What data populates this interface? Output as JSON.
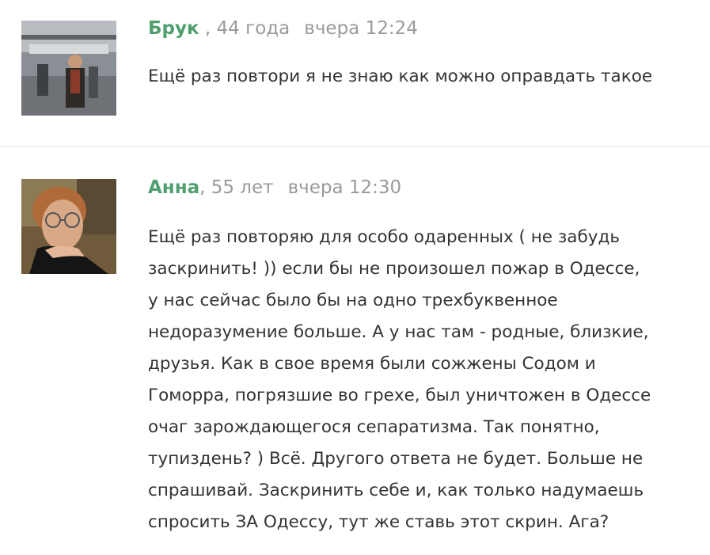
{
  "comments": [
    {
      "author": "Брук",
      "age": " , 44 года",
      "time": "вчера 12:24",
      "lines": [
        "Ещё раз повтори я не знаю как можно оправдать такое"
      ]
    },
    {
      "author": "Анна",
      "age": ", 55 лет",
      "time": "вчера 12:30",
      "lines": [
        "Ещё раз повторяю для особо одаренных ( не забудь",
        "заскринить! )) если бы не произошел пожар в Одессе,",
        "у нас сейчас было бы на одно трехбуквенное",
        "недоразумение больше. А у нас там - родные, близкие,",
        "друзья. Как в свое время были сожжены Содом и",
        "Гоморра, погрязшие во грехе, был уничтожен в Одессе",
        "очаг зарождающегося сепаратизма. Так понятно,",
        "тупиздень? ) Всё. Другого ответа не будет. Больше не",
        "спрашивай. Заскринить себе и, как только надумаешь",
        "спросить ЗА Одессу, тут же ставь этот скрин. Ага?"
      ]
    }
  ],
  "colors": {
    "author": "#4f9f6e",
    "meta": "#9a9a9a",
    "text": "#333333",
    "divider": "#e4e4e4"
  }
}
